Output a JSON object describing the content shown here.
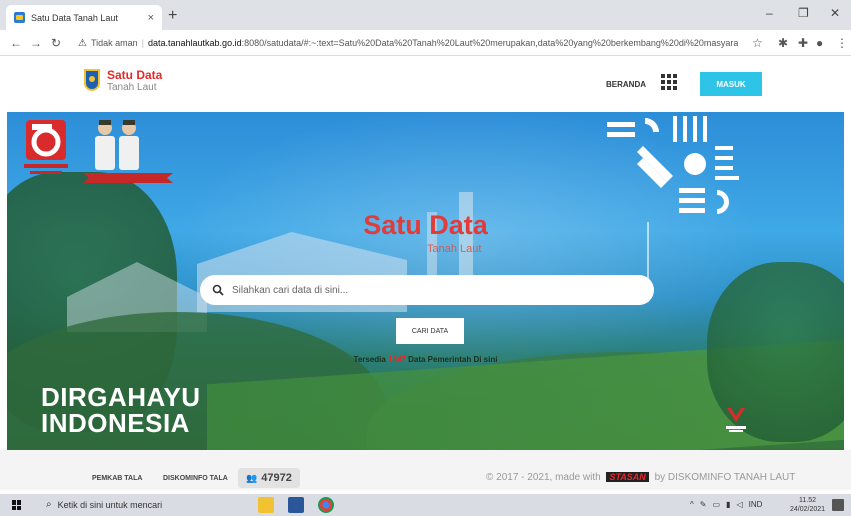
{
  "browser": {
    "tab_title": "Satu Data Tanah Laut",
    "tab_close": "×",
    "new_tab": "+",
    "security_label": "Tidak aman",
    "url_host": "data.tanahlautkab.go.id",
    "url_rest": ":8080/satudata/#:~:text=Satu%20Data%20Tanah%20Laut%20merupakan,data%20yang%20berkembang%20di%20masyarakat.",
    "window_controls": [
      "–",
      "❐",
      "✕"
    ]
  },
  "header": {
    "logo_title": "Satu Data",
    "logo_subtitle": "Tanah Laut",
    "nav_beranda": "BERANDA",
    "login_button": "MASUK"
  },
  "hero": {
    "title": "Satu Data",
    "subtitle": "Tanah Laut",
    "search_placeholder": "Silahkan cari data di sini...",
    "search_button": "CARI DATA",
    "tersedia_prefix": "Tersedia ",
    "tersedia_count": "1347",
    "tersedia_suffix": " Data Pemerintah Di sini",
    "dirgahayu_line1": "DIRGAHAYU",
    "dirgahayu_line2": "INDONESIA"
  },
  "footer": {
    "link_pemkab": "PEMKAB TALA",
    "link_diskominfo": "DISKOMINFO TALA",
    "visitor_count": "47972",
    "copyright_prefix": "© 2017 - 2021, made with",
    "copyright_brand": "STASAN",
    "copyright_suffix": "by DISKOMINFO TANAH LAUT"
  },
  "taskbar": {
    "search_placeholder": "Ketik di sini untuk mencari",
    "lang": "IND",
    "time": "11.52",
    "date": "24/02/2021"
  },
  "colors": {
    "brand_red": "#e02b2b",
    "button_cyan": "#2ec4e8"
  }
}
